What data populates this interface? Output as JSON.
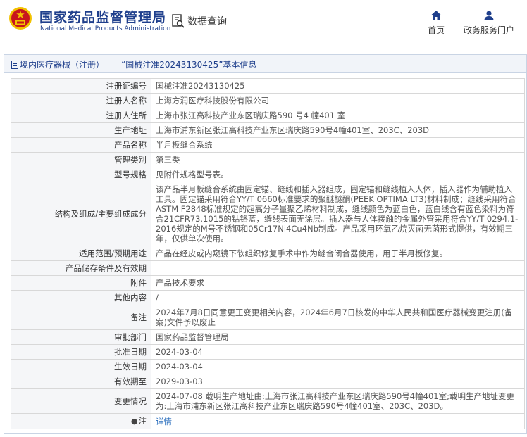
{
  "header": {
    "title": "国家药品监督管理局",
    "subtitle": "National Medical Products Administration",
    "search_label": "数据查询",
    "nav": [
      {
        "label": "首页",
        "icon": "home-icon"
      },
      {
        "label": "政务服务门户",
        "icon": "user-icon"
      }
    ]
  },
  "breadcrumb": "境内医疗器械（注册）——“国械注准20243130425”基本信息",
  "colors": {
    "brand": "#1f3f8c",
    "link": "#2a6ebd",
    "emblem_red": "#c8151d",
    "emblem_gold": "#f2c200"
  },
  "rows": [
    {
      "key": "注册证编号",
      "value": "国械注准20243130425"
    },
    {
      "key": "注册人名称",
      "value": "上海方润医疗科技股份有限公司"
    },
    {
      "key": "注册人住所",
      "value": "上海市张江高科技产业东区瑞庆路590 号4 幢401 室"
    },
    {
      "key": "生产地址",
      "value": "上海市浦东新区张江高科技产业东区瑞庆路590号4幢401室、203C、203D"
    },
    {
      "key": "产品名称",
      "value": "半月板缝合系统"
    },
    {
      "key": "管理类别",
      "value": "第三类"
    },
    {
      "key": "型号规格",
      "value": "见附件规格型号表。"
    },
    {
      "key": "结构及组成/主要组成成分",
      "value": "该产品半月板缝合系统由固定锚、缝线和插入器组成，固定锚和缝线植入人体，插入器作为辅助植入工具。固定锚采用符合YY/T 0660标准要求的聚醚醚酮(PEEK OPTIMA LT3)材料制成；缝线采用符合ASTM F2848标准规定的超高分子量聚乙烯材料制成，缝线颜色为蓝白色，蓝白线含有蓝色染料为符合21CFR73.1015的钴铬蓝，缝线表面无涂层。插入器与人体接触的金属外管采用符合YY/T 0294.1-2016规定的M号不锈钢和05Cr17Ni4Cu4Nb制成。产品采用环氧乙烷灭菌无菌形式提供，有效期三年，仅供单次使用。"
    },
    {
      "key": "适用范围/预期用途",
      "value": "产品在经皮或内窥镜下软组织修复手术中作为缝合闭合器使用，用于半月板修复。"
    },
    {
      "key": "产品储存条件及有效期",
      "value": ""
    },
    {
      "key": "附件",
      "value": "产品技术要求"
    },
    {
      "key": "其他内容",
      "value": "/"
    },
    {
      "key": "备注",
      "value": "2024年7月8日同意更正变更相关内容，2024年6月7日核发的中华人民共和国医疗器械变更注册(备案)文件予以废止"
    },
    {
      "key": "审批部门",
      "value": "国家药品监督管理局"
    },
    {
      "key": "批准日期",
      "value": "2024-03-04"
    },
    {
      "key": "生效日期",
      "value": "2024-03-04"
    },
    {
      "key": "有效期至",
      "value": "2029-03-03"
    },
    {
      "key": "变更情况",
      "value": "2024-07-08 载明生产地址由:上海市张江高科技产业东区瑞庆路590号4幢401室;载明生产地址变更为:上海市浦东新区张江高科技产业东区瑞庆路590号4幢401室、203C、203D。"
    },
    {
      "key": "注",
      "value": "详情",
      "icon": "tip-bullet-icon"
    }
  ]
}
